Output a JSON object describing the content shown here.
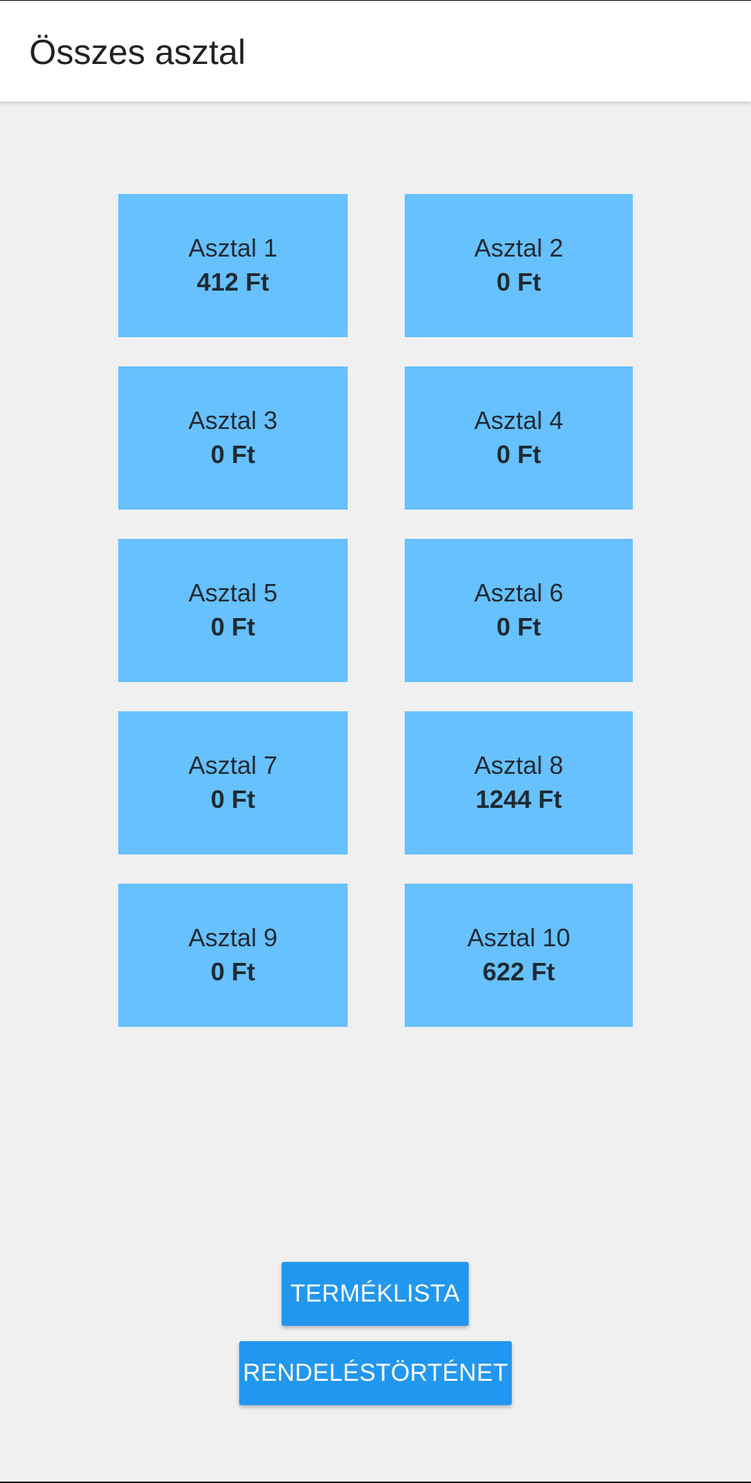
{
  "header": {
    "title": "Összes asztal"
  },
  "tables": [
    {
      "name": "Asztal 1",
      "total": "412 Ft"
    },
    {
      "name": "Asztal 2",
      "total": "0 Ft"
    },
    {
      "name": "Asztal 3",
      "total": "0 Ft"
    },
    {
      "name": "Asztal 4",
      "total": "0 Ft"
    },
    {
      "name": "Asztal 5",
      "total": "0 Ft"
    },
    {
      "name": "Asztal 6",
      "total": "0 Ft"
    },
    {
      "name": "Asztal 7",
      "total": "0 Ft"
    },
    {
      "name": "Asztal 8",
      "total": "1244 Ft"
    },
    {
      "name": "Asztal 9",
      "total": "0 Ft"
    },
    {
      "name": "Asztal 10",
      "total": "622 Ft"
    }
  ],
  "actions": {
    "products_label": "TERMÉKLISTA",
    "history_label": "RENDELÉSTÖRTÉNET"
  },
  "colors": {
    "table_card": "#66c1fe",
    "primary_button": "#2297f0",
    "background": "#f0f0f0"
  }
}
